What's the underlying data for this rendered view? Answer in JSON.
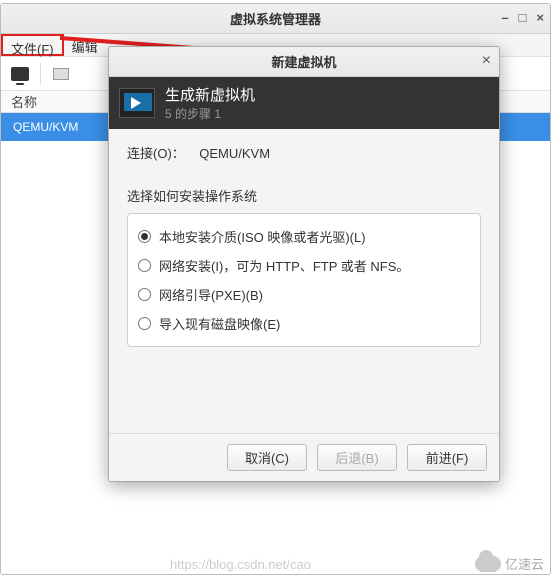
{
  "main_window": {
    "title": "虚拟系统管理器",
    "window_controls": {
      "min": "–",
      "max": "□",
      "close": "×"
    },
    "menu": {
      "file": "文件(F)",
      "edit": "编辑"
    },
    "list": {
      "header": "名称",
      "rows": [
        "QEMU/KVM"
      ]
    }
  },
  "dialog": {
    "title": "新建虚拟机",
    "header_title": "生成新虚拟机",
    "step": "5 的步骤 1",
    "connection_label": "连接(O)：",
    "connection_value": "QEMU/KVM",
    "prompt": "选择如何安装操作系统",
    "options": [
      {
        "label": "本地安装介质(ISO 映像或者光驱)(L)",
        "checked": true
      },
      {
        "label": "网络安装(I)，可为 HTTP、FTP 或者 NFS。",
        "checked": false
      },
      {
        "label": "网络引导(PXE)(B)",
        "checked": false
      },
      {
        "label": "导入现有磁盘映像(E)",
        "checked": false
      }
    ],
    "buttons": {
      "cancel": "取消(C)",
      "back": "后退(B)",
      "forward": "前进(F)"
    },
    "close": "×"
  },
  "watermark": {
    "text": "https://blog.csdn.net/cao",
    "brand": "亿速云"
  }
}
